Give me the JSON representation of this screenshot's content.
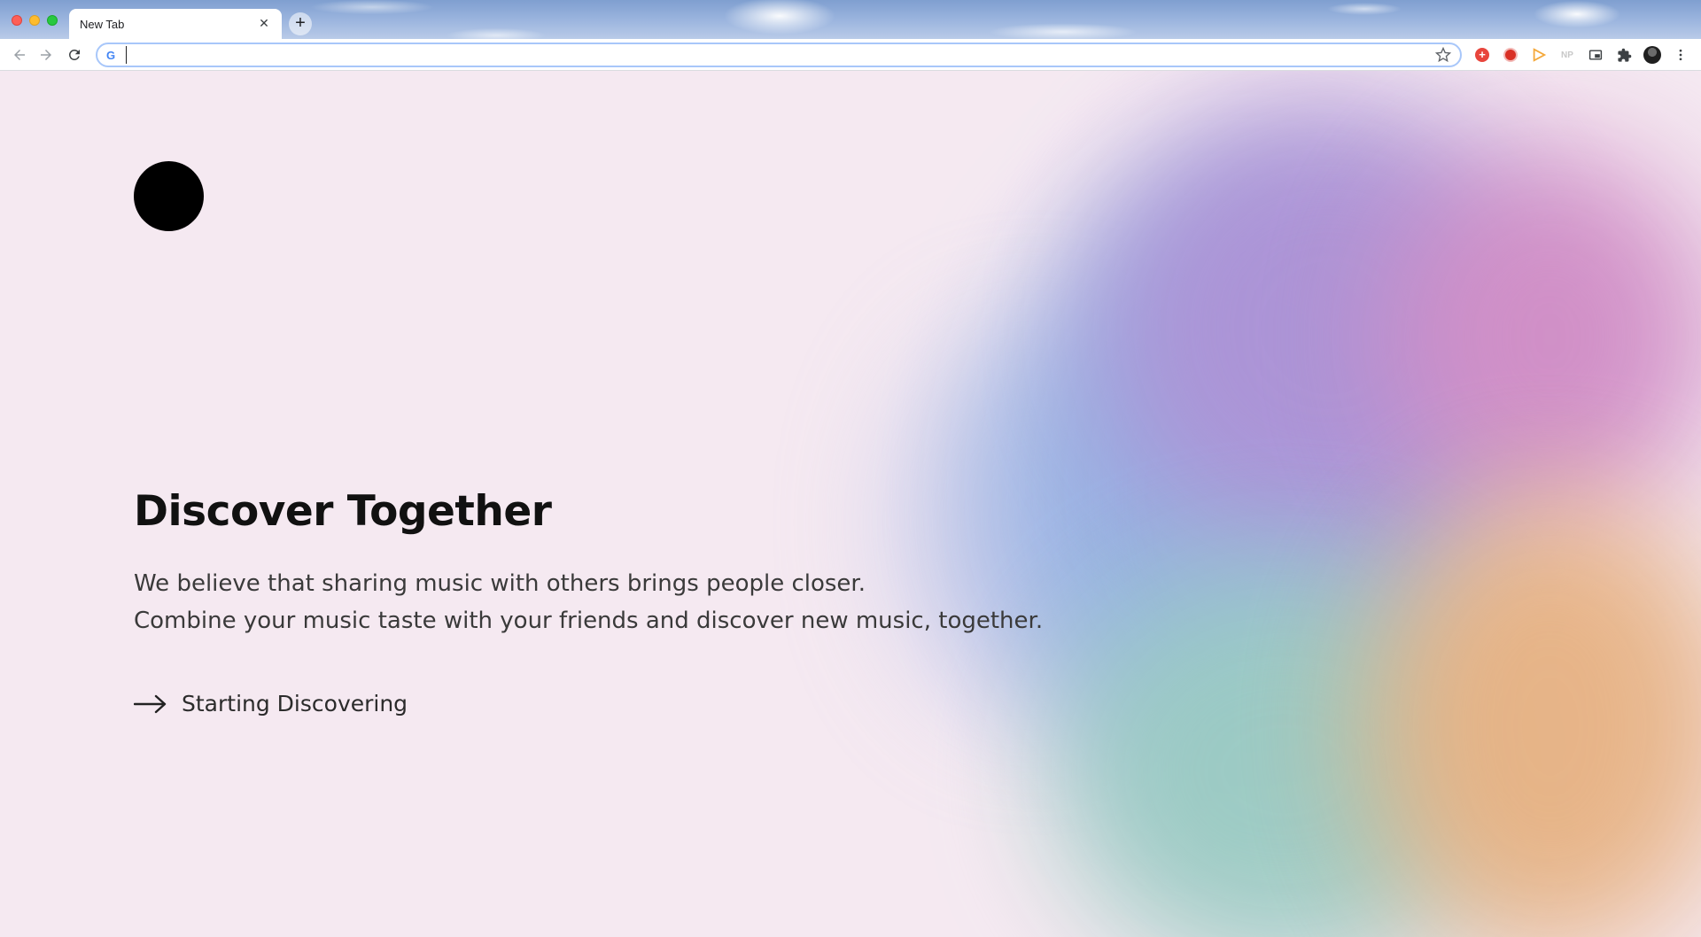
{
  "browser": {
    "tab": {
      "title": "New Tab",
      "close_icon": "close-icon"
    },
    "new_tab_icon": "plus-icon",
    "address_bar": {
      "value": "",
      "provider_icon": "google-g-icon",
      "provider_label": "G"
    },
    "extensions": [
      {
        "name": "red-plus-extension-icon",
        "color": "#e8453c"
      },
      {
        "name": "red-hand-extension-icon",
        "color": "#d93025"
      },
      {
        "name": "orange-play-extension-icon",
        "color": "#f4a83a"
      },
      {
        "name": "np-extension-icon",
        "label": "NP"
      },
      {
        "name": "picture-in-picture-icon"
      },
      {
        "name": "puzzle-icon"
      },
      {
        "name": "profile-avatar-icon"
      },
      {
        "name": "kebab-menu-icon"
      }
    ]
  },
  "page": {
    "headline": "Discover Together",
    "description_line_1": "We believe that sharing music with others brings people closer.",
    "description_line_2": "Combine your music taste with your friends and discover new music, together.",
    "cta_label": "Starting Discovering",
    "cta_icon": "arrow-right-icon"
  },
  "colors": {
    "background": "#f5e9f1",
    "text_primary": "#111111",
    "text_secondary": "#3a3a3a",
    "logo": "#000000"
  }
}
